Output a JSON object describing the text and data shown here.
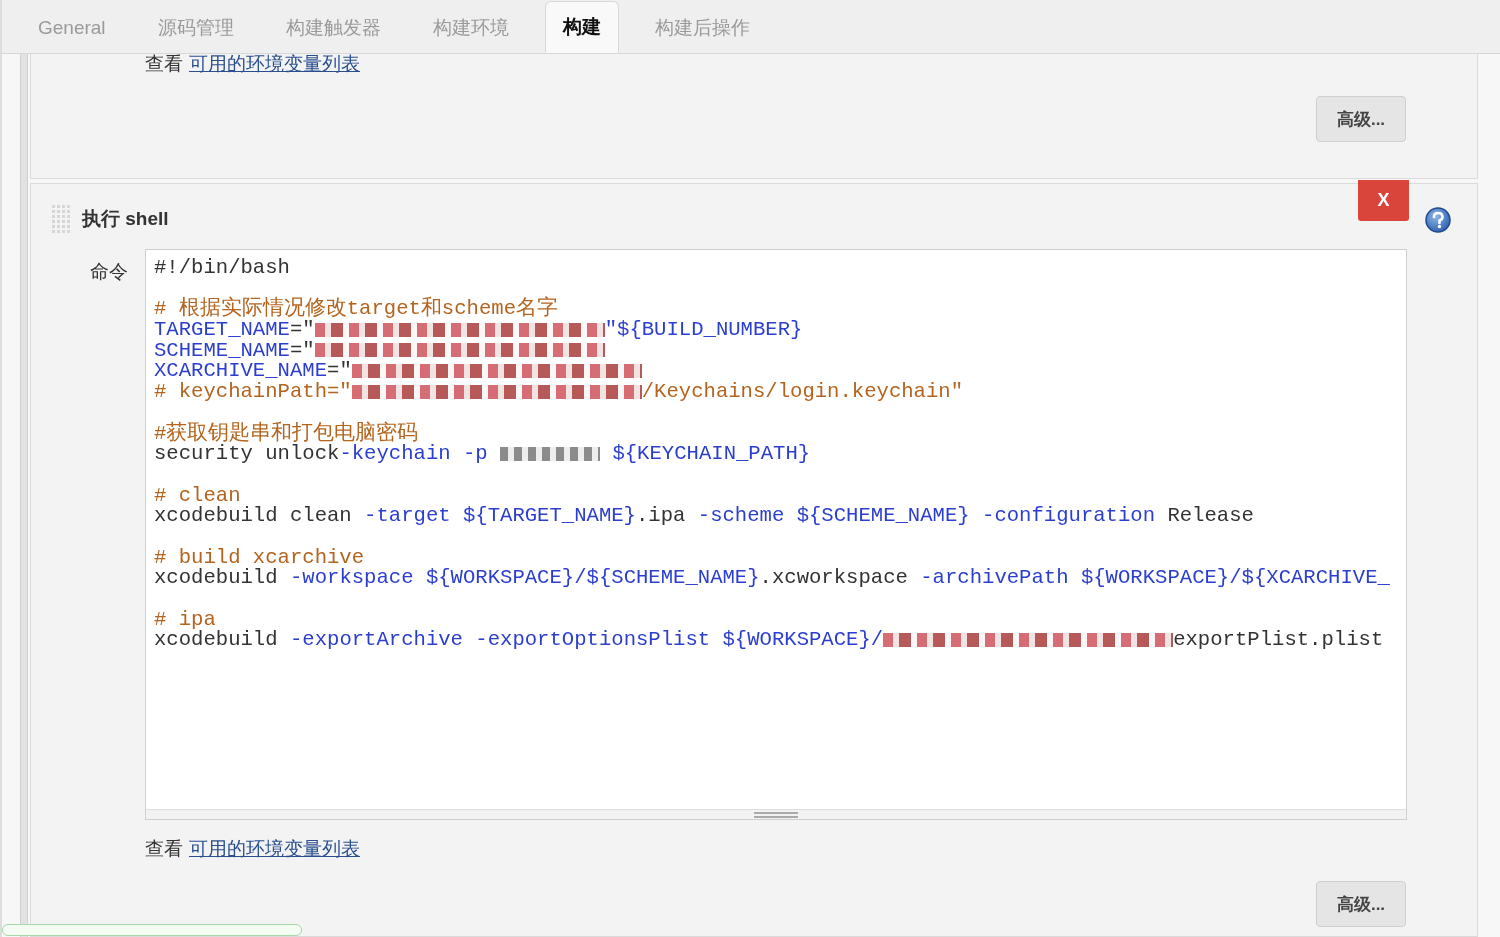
{
  "tabs": [
    {
      "label": "General",
      "selected": false
    },
    {
      "label": "源码管理",
      "selected": false
    },
    {
      "label": "构建触发器",
      "selected": false
    },
    {
      "label": "构建环境",
      "selected": false
    },
    {
      "label": "构建",
      "selected": true
    },
    {
      "label": "构建后操作",
      "selected": false
    }
  ],
  "sections": [
    {
      "kind": "tail",
      "link_prefix": "查看",
      "link": "可用的环境变量列表",
      "advanced_button": "高级..."
    },
    {
      "kind": "shell",
      "title": "执行 shell",
      "delete_button": "X",
      "field_label": "命令",
      "code": {
        "blocks": [
          {
            "lines": [
              [
                {
                  "kind": "plain",
                  "text": "#!/bin/bash"
                }
              ]
            ]
          },
          {
            "lines": [
              [
                {
                  "kind": "comment",
                  "text": "# 根据实际情况修改target和scheme名字"
                }
              ],
              [
                {
                  "kind": "name",
                  "text": "TARGET_NAME"
                },
                {
                  "kind": "plain",
                  "text": "=\""
                },
                {
                  "kind": "blur"
                },
                {
                  "kind": "name",
                  "text": "\"${BUILD_NUMBER}"
                }
              ],
              [
                {
                  "kind": "name",
                  "text": "SCHEME_NAME"
                },
                {
                  "kind": "plain",
                  "text": "=\""
                },
                {
                  "kind": "blur"
                }
              ],
              [
                {
                  "kind": "name",
                  "text": "XCARCHIVE_NAME"
                },
                {
                  "kind": "plain",
                  "text": "=\""
                },
                {
                  "kind": "blur"
                }
              ],
              [
                {
                  "kind": "comment",
                  "text": "# keychainPath=\""
                },
                {
                  "kind": "blur"
                },
                {
                  "kind": "comment",
                  "text": "/Keychains/login.keychain\""
                }
              ]
            ]
          },
          {
            "lines": [
              [
                {
                  "kind": "comment",
                  "text": "#获取钥匙串和打包电脑密码"
                }
              ],
              [
                {
                  "kind": "plain",
                  "text": "security unlock"
                },
                {
                  "kind": "name",
                  "text": "-keychain -p "
                },
                {
                  "kind": "smudge"
                },
                {
                  "kind": "name",
                  "text": " ${KEYCHAIN_PATH}"
                }
              ]
            ]
          },
          {
            "lines": [
              [
                {
                  "kind": "comment",
                  "text": "# clean"
                }
              ],
              [
                {
                  "kind": "plain",
                  "text": "xcodebuild clean "
                },
                {
                  "kind": "name",
                  "text": "-target ${TARGET_NAME}"
                },
                {
                  "kind": "plain",
                  "text": ".ipa "
                },
                {
                  "kind": "name",
                  "text": "-scheme ${SCHEME_NAME} -configuration"
                },
                {
                  "kind": "plain",
                  "text": " Release"
                }
              ]
            ]
          },
          {
            "lines": [
              [
                {
                  "kind": "comment",
                  "text": "# build xcarchive"
                }
              ],
              [
                {
                  "kind": "plain",
                  "text": "xcodebuild "
                },
                {
                  "kind": "name",
                  "text": "-workspace ${WORKSPACE}/${SCHEME_NAME}"
                },
                {
                  "kind": "plain",
                  "text": ".xcworkspace "
                },
                {
                  "kind": "name",
                  "text": "-archivePath ${WORKSPACE}/${XCARCHIVE_"
                }
              ]
            ]
          },
          {
            "lines": [
              [
                {
                  "kind": "comment",
                  "text": "# ipa"
                }
              ],
              [
                {
                  "kind": "plain",
                  "text": "xcodebuild "
                },
                {
                  "kind": "name",
                  "text": "-exportArchive -exportOptionsPlist ${WORKSPACE}/"
                },
                {
                  "kind": "blur"
                },
                {
                  "kind": "plain",
                  "text": "exportPlist.plist"
                }
              ]
            ]
          }
        ]
      },
      "link_prefix": "查看",
      "link": "可用的环境变量列表",
      "advanced_button": "高级..."
    }
  ]
}
